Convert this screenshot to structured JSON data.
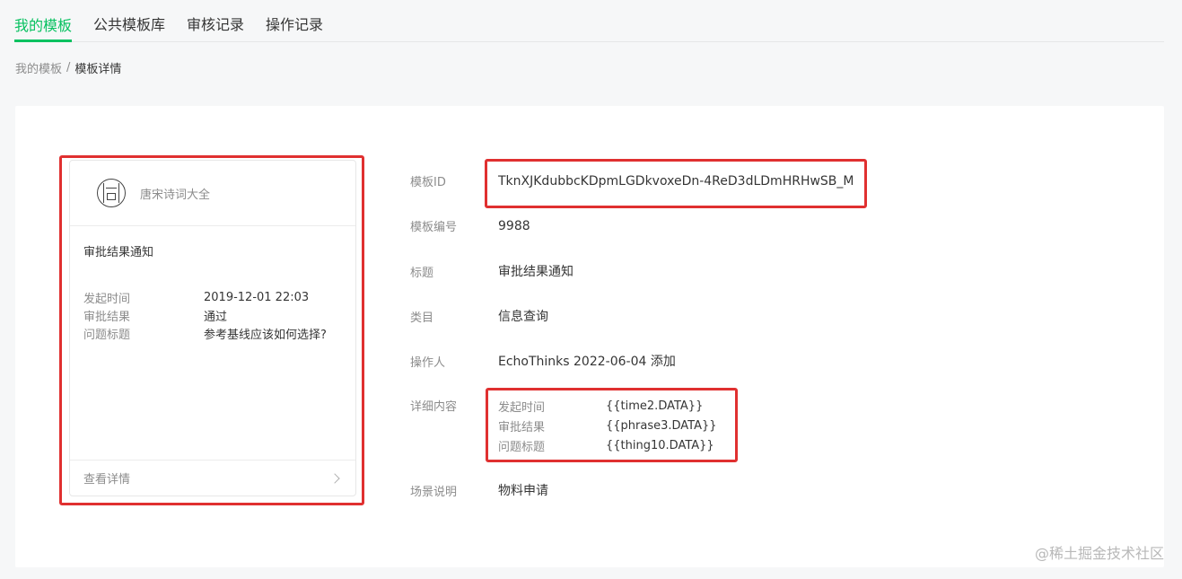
{
  "tabs": [
    {
      "label": "我的模板",
      "active": true
    },
    {
      "label": "公共模板库",
      "active": false
    },
    {
      "label": "审核记录",
      "active": false
    },
    {
      "label": "操作记录",
      "active": false
    }
  ],
  "breadcrumb": {
    "parent": "我的模板",
    "separator": "/",
    "current": "模板详情"
  },
  "preview_card": {
    "account_name": "唐宋诗词大全",
    "title": "审批结果通知",
    "rows": [
      {
        "key": "发起时间",
        "value": "2019-12-01 22:03"
      },
      {
        "key": "审批结果",
        "value": "通过"
      },
      {
        "key": "问题标题",
        "value": "参考基线应该如何选择?"
      }
    ],
    "footer_label": "查看详情"
  },
  "details": {
    "template_id": {
      "label": "模板ID",
      "value": "TknXJKdubbcKDpmLGDkvoxeDn-4ReD3dLDmHRHwSB_M"
    },
    "template_no": {
      "label": "模板编号",
      "value": "9988"
    },
    "title": {
      "label": "标题",
      "value": "审批结果通知"
    },
    "category": {
      "label": "类目",
      "value": "信息查询"
    },
    "operator": {
      "label": "操作人",
      "value": "EchoThinks 2022-06-04 添加"
    },
    "content": {
      "label": "详细内容",
      "lines": [
        {
          "key": "发起时间",
          "value": "{{time2.DATA}}"
        },
        {
          "key": "审批结果",
          "value": "{{phrase3.DATA}}"
        },
        {
          "key": "问题标题",
          "value": "{{thing10.DATA}}"
        }
      ]
    },
    "scene": {
      "label": "场景说明",
      "value": "物料申请"
    }
  },
  "watermark": "@稀土掘金技术社区",
  "colors": {
    "accent": "#07c160",
    "highlight": "#e03030",
    "muted_text": "#8c8c8c",
    "text": "#353535"
  }
}
